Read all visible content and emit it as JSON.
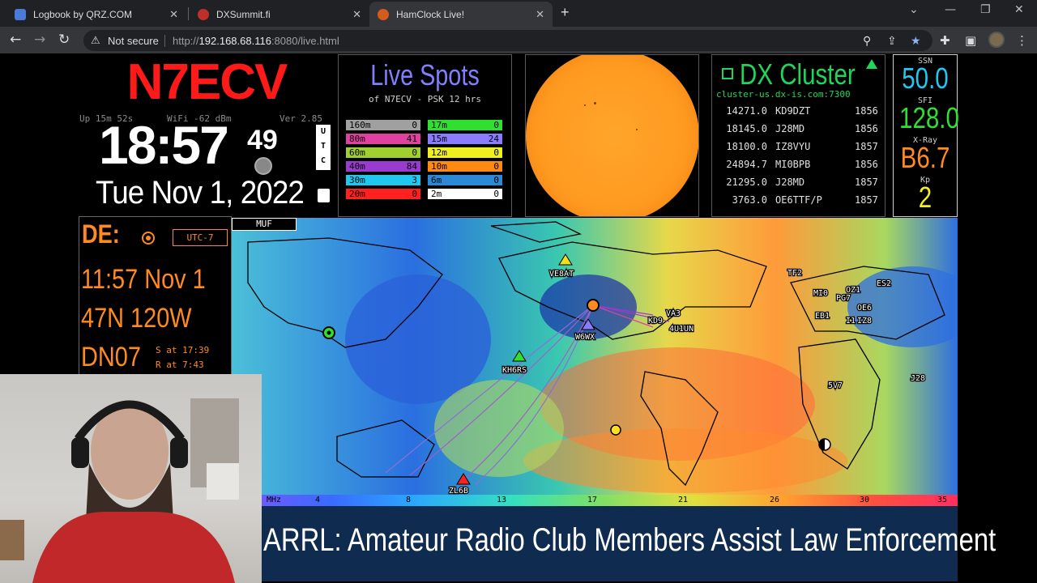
{
  "browser": {
    "tabs": [
      {
        "title": "Logbook by QRZ.COM",
        "favicon_color": "#4a7bd6"
      },
      {
        "title": "DXSummit.fi",
        "favicon_color": "#c0302a"
      },
      {
        "title": "HamClock Live!",
        "favicon_color": "#d45a1e"
      }
    ],
    "security_label": "Not secure",
    "url_prefix": "http://",
    "url_host": "192.168.68.116",
    "url_rest": ":8080/live.html"
  },
  "clock": {
    "callsign": "N7ECV",
    "uptime": "Up 15m 52s",
    "wifi": "WiFi -62 dBm",
    "version": "Ver 2.85",
    "time_hm": "18:57",
    "time_s": "49",
    "utc": [
      "U",
      "T",
      "C"
    ],
    "date": "Tue Nov 1, 2022"
  },
  "live_spots": {
    "title": "Live Spots",
    "subtitle": "of N7ECV - PSK 12 hrs",
    "bands": [
      {
        "band": "160m",
        "count": "0",
        "bg": "#a0a0a0",
        "fg": "#000"
      },
      {
        "band": "17m",
        "count": "0",
        "bg": "#30e030",
        "fg": "#000"
      },
      {
        "band": "80m",
        "count": "41",
        "bg": "#e040a0",
        "fg": "#000"
      },
      {
        "band": "15m",
        "count": "24",
        "bg": "#8a7cff",
        "fg": "#000"
      },
      {
        "band": "60m",
        "count": "0",
        "bg": "#a0d030",
        "fg": "#000"
      },
      {
        "band": "12m",
        "count": "0",
        "bg": "#f0f020",
        "fg": "#000"
      },
      {
        "band": "40m",
        "count": "84",
        "bg": "#9a3ad0",
        "fg": "#000"
      },
      {
        "band": "10m",
        "count": "0",
        "bg": "#ff8a10",
        "fg": "#000"
      },
      {
        "band": "30m",
        "count": "3",
        "bg": "#20c8f0",
        "fg": "#000"
      },
      {
        "band": "6m",
        "count": "0",
        "bg": "#2a8ad8",
        "fg": "#000"
      },
      {
        "band": "20m",
        "count": "0",
        "bg": "#ff2020",
        "fg": "#000"
      },
      {
        "band": "2m",
        "count": "0",
        "bg": "#ffffff",
        "fg": "#000"
      }
    ]
  },
  "dx_cluster": {
    "title": "DX Cluster",
    "host": "cluster-us.dx-is.com:7300",
    "spots": [
      {
        "freq": "14271.0",
        "call": "KD9DZT",
        "time": "1856"
      },
      {
        "freq": "18145.0",
        "call": "J28MD",
        "time": "1856"
      },
      {
        "freq": "18100.0",
        "call": "IZ8VYU",
        "time": "1857"
      },
      {
        "freq": "24894.7",
        "call": "MI0BPB",
        "time": "1856"
      },
      {
        "freq": "21295.0",
        "call": "J28MD",
        "time": "1857"
      },
      {
        "freq": "3763.0",
        "call": "OE6TTF/P",
        "time": "1857"
      }
    ]
  },
  "space_wx": {
    "ssn_label": "SSN",
    "ssn": "50.0",
    "sfi_label": "SFI",
    "sfi": "128.0",
    "xray_label": "X-Ray",
    "xray": "B6.7",
    "kp_label": "Kp",
    "kp": "2"
  },
  "de": {
    "label": "DE:",
    "tz": "UTC-7",
    "time": "11:57 Nov 1",
    "latlon": "47N  120W",
    "grid": "DN07",
    "sunset": "S at 17:39",
    "sunrise": "R at 7:43"
  },
  "map": {
    "mode_label": "MUF",
    "labels": [
      "VE8AT",
      "W6WX",
      "KH6RS",
      "ZL6B",
      "KD9",
      "VA3",
      "4U1UN",
      "TF2",
      "MI0",
      "OZ1",
      "ES2",
      "PG7",
      "OE6",
      "EB1",
      "IZ8",
      "I1",
      "5V7",
      "J28"
    ]
  },
  "muf_scale": {
    "unit": "MHz",
    "ticks": [
      "4",
      "8",
      "13",
      "17",
      "21",
      "26",
      "30",
      "35"
    ]
  },
  "news": {
    "headline": "ARRL: Amateur Radio Club Members Assist Law Enforcement"
  }
}
